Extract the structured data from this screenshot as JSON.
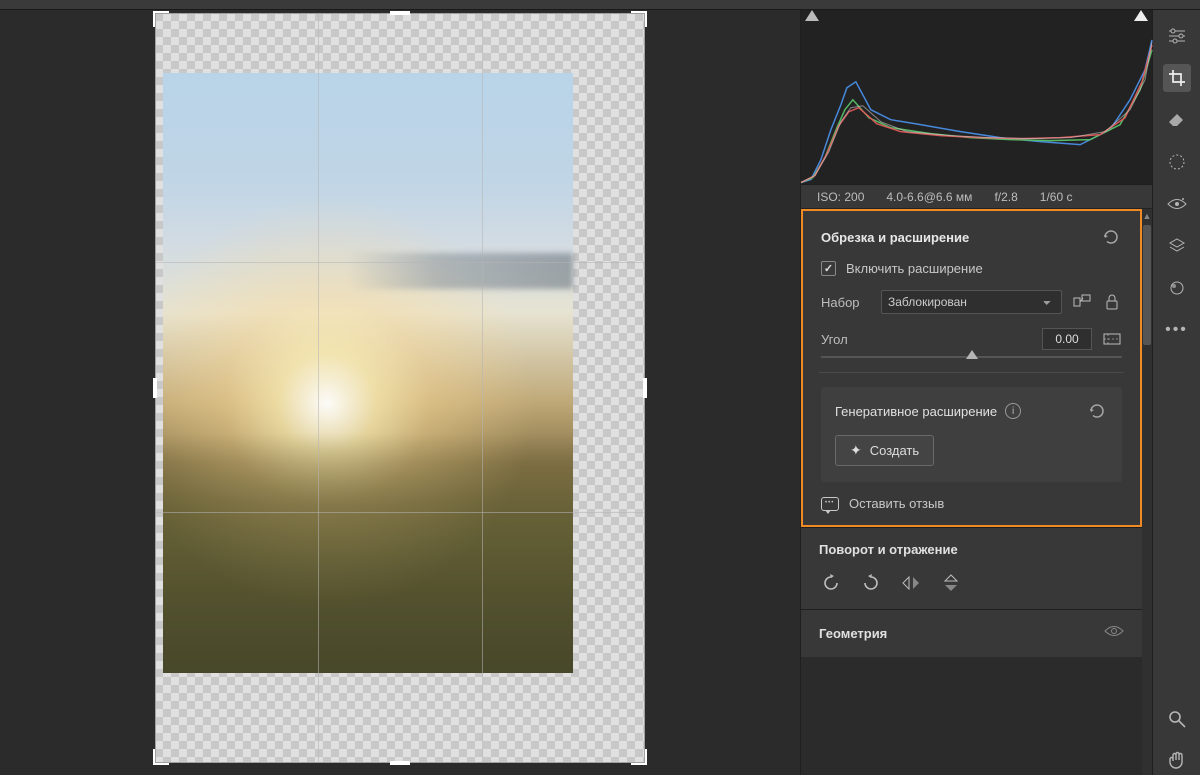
{
  "meta": {
    "iso": "ISO: 200",
    "focal": "4.0-6.6@6.6 мм",
    "aperture": "f/2.8",
    "shutter": "1/60 c"
  },
  "crop": {
    "title": "Обрезка и расширение",
    "enable_label": "Включить расширение",
    "preset_label": "Набор",
    "preset_value": "Заблокирован",
    "angle_label": "Угол",
    "angle_value": "0.00"
  },
  "generative": {
    "title": "Генеративное расширение",
    "create_label": "Создать"
  },
  "feedback": {
    "label": "Оставить отзыв"
  },
  "rotate": {
    "title": "Поворот и отражение"
  },
  "geometry": {
    "title": "Геометрия"
  }
}
